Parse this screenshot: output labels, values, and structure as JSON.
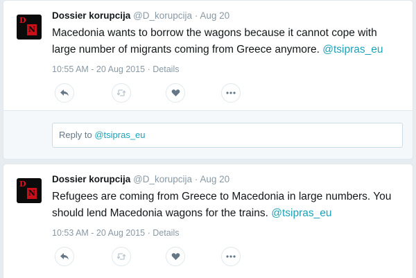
{
  "colors": {
    "background": "#e6ecf0",
    "mention": "#1da1b8",
    "muted": "#8899a6",
    "avatar_red": "#e0141e"
  },
  "tweets": [
    {
      "fullname": "Dossier korupcija",
      "username": "@D_korupcija",
      "dot": "·",
      "time": "Aug 20",
      "text": "Macedonia wants to borrow the wagons because it cannot cope with large number of migrants coming from Greece anymore.",
      "mention": "@tsipras_eu",
      "timestamp": "10:55 AM - 20 Aug 2015",
      "details": "Details",
      "avatar_letters": [
        "D",
        "N"
      ],
      "icons": [
        "reply-icon",
        "retweet-icon",
        "like-icon",
        "more-icon"
      ]
    },
    {
      "fullname": "Dossier korupcija",
      "username": "@D_korupcija",
      "dot": "·",
      "time": "Aug 20",
      "text": "Refugees are coming from Greece to Macedonia in large numbers. You should lend Macedonia wagons for the trains.",
      "mention": "@tsipras_eu",
      "timestamp": "10:53 AM - 20 Aug 2015",
      "details": "Details",
      "avatar_letters": [
        "D",
        "N"
      ],
      "icons": [
        "reply-icon",
        "retweet-icon",
        "like-icon",
        "more-icon"
      ]
    }
  ],
  "reply": {
    "prefix": "Reply to",
    "mention": "@tsipras_eu"
  }
}
